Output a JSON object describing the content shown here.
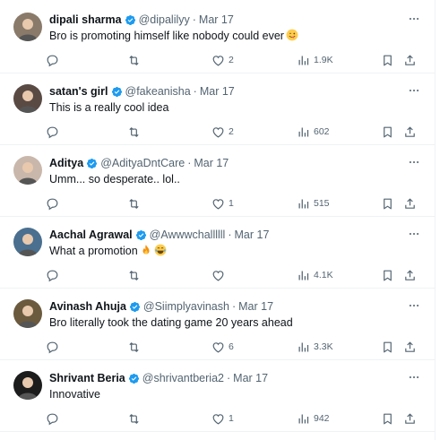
{
  "tweets": [
    {
      "name": "dipali sharma",
      "handle": "@dipalilyy",
      "date": "Mar 17",
      "text": "Bro is promoting himself like nobody could ever",
      "emoji": [
        "winking-tongue-face"
      ],
      "replies": "",
      "retweets": "",
      "likes": "2",
      "views": "1.9K",
      "avatar_color": "#8a7a6a"
    },
    {
      "name": "satan's girl",
      "handle": "@fakeanisha",
      "date": "Mar 17",
      "text": "This is a really cool idea",
      "emoji": [],
      "replies": "",
      "retweets": "",
      "likes": "2",
      "views": "602",
      "avatar_color": "#5a4a44"
    },
    {
      "name": "Aditya",
      "handle": "@AdityaDntCare",
      "date": "Mar 17",
      "text": "Umm... so desperate.. lol..",
      "emoji": [],
      "replies": "",
      "retweets": "",
      "likes": "1",
      "views": "515",
      "avatar_color": "#c9b7ab"
    },
    {
      "name": "Aachal Agrawal",
      "handle": "@Awwwchallllll",
      "date": "Mar 17",
      "text": "What a promotion",
      "emoji": [
        "fire",
        "face-with-tears-of-joy"
      ],
      "replies": "",
      "retweets": "",
      "likes": "",
      "views": "4.1K",
      "avatar_color": "#4a6f8f"
    },
    {
      "name": "Avinash Ahuja",
      "handle": "@Siimplyavinash",
      "date": "Mar 17",
      "text": "Bro literally took the dating game 20 years ahead",
      "emoji": [],
      "replies": "",
      "retweets": "",
      "likes": "6",
      "views": "3.3K",
      "avatar_color": "#6b5a3e"
    },
    {
      "name": "Shrivant Beria",
      "handle": "@shrivantberia2",
      "date": "Mar 17",
      "text": "Innovative",
      "emoji": [],
      "replies": "",
      "retweets": "",
      "likes": "1",
      "views": "942",
      "avatar_color": "#1c1c1c"
    }
  ],
  "dot_separator": "·",
  "colors": {
    "verified": "#1d9bf0",
    "secondary_text": "#536471",
    "primary_text": "#0f1419",
    "divider": "#eff3f4"
  }
}
